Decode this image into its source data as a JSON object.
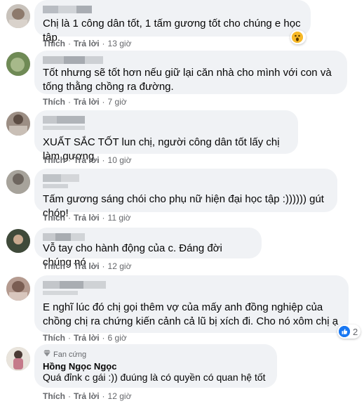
{
  "actions": {
    "like": "Thích",
    "reply": "Trả lời",
    "separator": "·"
  },
  "comments": [
    {
      "text": "Chị là 1 công dân tốt, 1 tấm gương tốt cho chúng e học tập.",
      "time": "13 giờ",
      "reaction": "wow"
    },
    {
      "text": "Tốt nhưng sẽ tốt hơn nếu giữ lại căn nhà cho mình với con và tống thằng chồng ra đường.",
      "time": "7 giờ"
    },
    {
      "text": "XUẤT SẮC TỐT lun chị, người công dân tốt lấy chị làm gương",
      "time": "10 giờ"
    },
    {
      "text": "Tấm gương sáng chói cho phụ nữ hiện đại học tập :)))))) gút chóp!",
      "time": "11 giờ"
    },
    {
      "text": "Vỗ tay cho hành động của c. Đáng đời chúng nó",
      "time": "12 giờ"
    },
    {
      "text": "E nghĩ lúc đó chị gọi thêm vợ của mấy anh đồng nghiệp của chồng chị ra chứng kiến cảnh cả lũ bị xích đi. Cho nó xôm chị ạ",
      "time": "6 giờ",
      "reaction": "like",
      "reaction_count": "2"
    },
    {
      "badge": "Fan cứng",
      "name": "Hồng Ngọc Ngọc",
      "text": "Quá đỉnk c gái :)) đuúng là có quyền có quan hệ tốt",
      "time": "12 giờ"
    }
  ],
  "colors": {
    "bubble": "#f0f2f5",
    "meta": "#65676b",
    "like_blue": "#1877f2",
    "wow_yellow": "#f7b928"
  },
  "icons": [
    "wow-reaction-icon",
    "like-reaction-icon",
    "fan-badge-icon"
  ]
}
